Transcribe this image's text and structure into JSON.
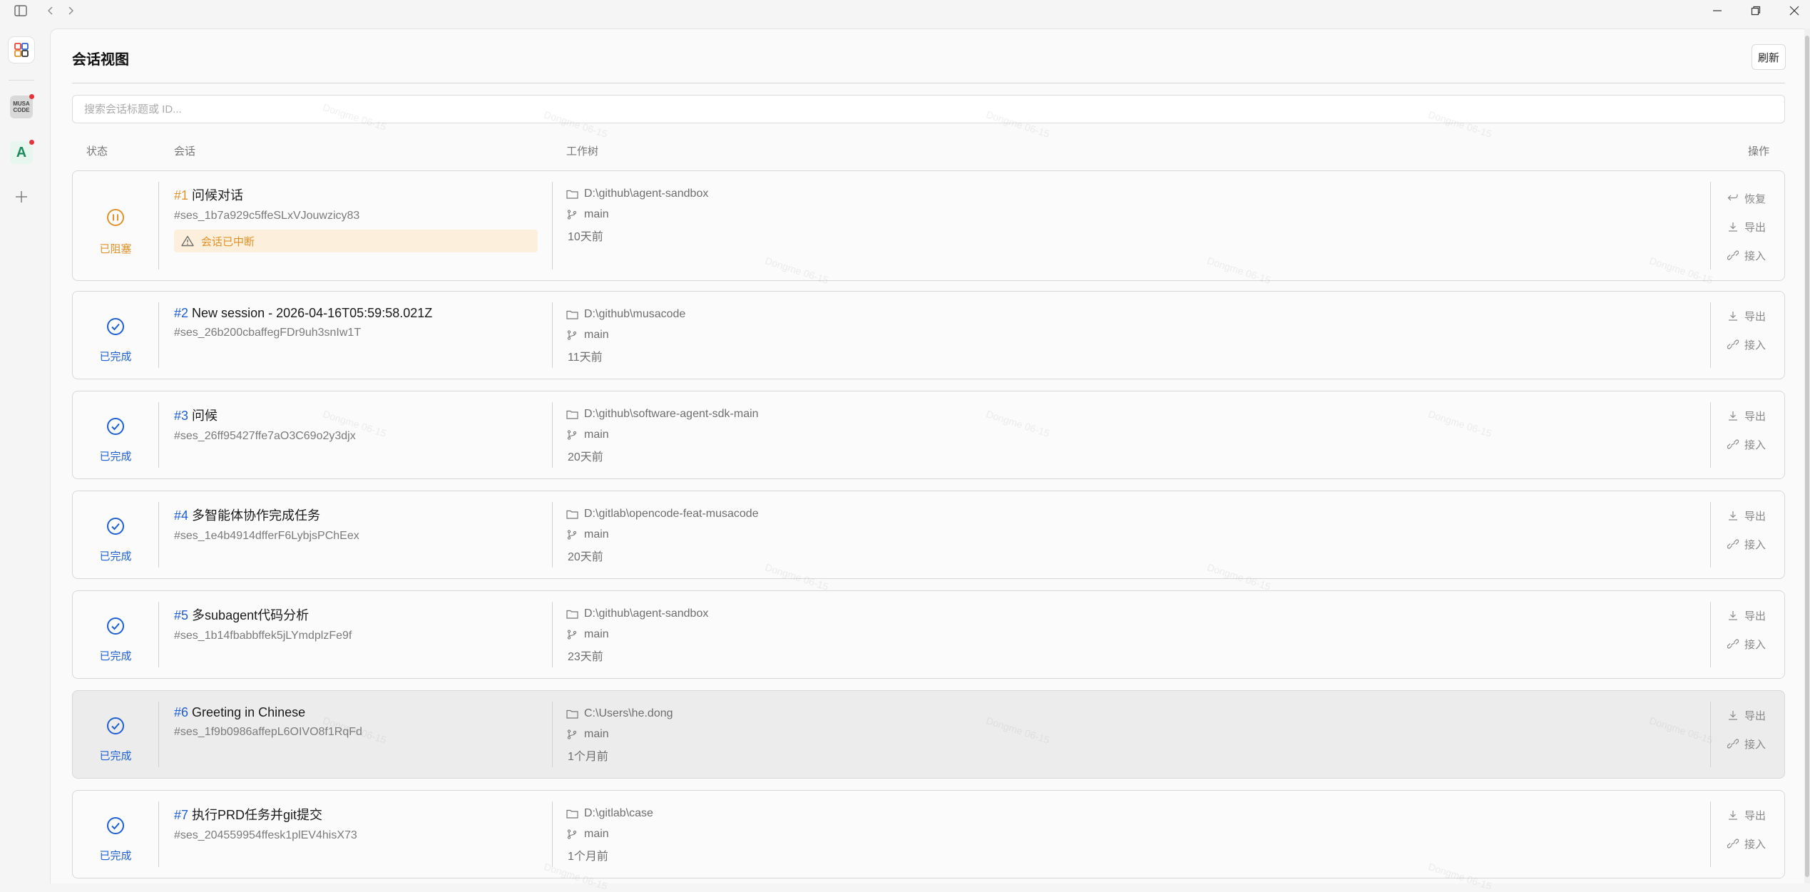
{
  "window": {
    "controls": [
      "sidebar-toggle-icon",
      "back-icon",
      "forward-icon",
      "minimize-icon",
      "restore-icon",
      "close-icon"
    ]
  },
  "rail": {
    "items": [
      {
        "name": "sessions-app",
        "icon": "grid-apps-icon",
        "active": true
      },
      {
        "name": "musacode-app",
        "icon_text": "MUSA CODE",
        "badge": true
      },
      {
        "name": "a-app",
        "icon_text": "A",
        "badge": true
      },
      {
        "name": "add-app",
        "icon": "plus-icon"
      }
    ]
  },
  "header": {
    "title": "会话视图",
    "refresh_label": "刷新"
  },
  "search": {
    "placeholder": "搜索会话标题或 ID..."
  },
  "columns": {
    "status": "状态",
    "session": "会话",
    "worktree": "工作树",
    "actions": "操作"
  },
  "colors": {
    "accent_blue": "#1f5fd6",
    "warn_orange": "#e0922a",
    "warn_bg": "#fcefdc"
  },
  "sessions": [
    {
      "num": "#1",
      "title": "问候对话",
      "id": "#ses_1b7a929c5ffeSLxVJouwzicy83",
      "status": "已阻塞",
      "status_kind": "blocked",
      "notice": "会话已中断",
      "path": "D:\\github\\agent-sandbox",
      "branch": "main",
      "time": "10天前",
      "actions": [
        "恢复",
        "导出",
        "接入"
      ]
    },
    {
      "num": "#2",
      "title": "New session - 2026-04-16T05:59:58.021Z",
      "id": "#ses_26b200cbaffegFDr9uh3snIw1T",
      "status": "已完成",
      "status_kind": "done",
      "path": "D:\\github\\musacode",
      "branch": "main",
      "time": "11天前",
      "actions": [
        "导出",
        "接入"
      ]
    },
    {
      "num": "#3",
      "title": "问候",
      "id": "#ses_26ff95427ffe7aO3C69o2y3djx",
      "status": "已完成",
      "status_kind": "done",
      "path": "D:\\github\\software-agent-sdk-main",
      "branch": "main",
      "time": "20天前",
      "actions": [
        "导出",
        "接入"
      ]
    },
    {
      "num": "#4",
      "title": "多智能体协作完成任务",
      "id": "#ses_1e4b4914dfferF6LybjsPChEex",
      "status": "已完成",
      "status_kind": "done",
      "path": "D:\\gitlab\\opencode-feat-musacode",
      "branch": "main",
      "time": "20天前",
      "actions": [
        "导出",
        "接入"
      ]
    },
    {
      "num": "#5",
      "title": "多subagent代码分析",
      "id": "#ses_1b14fbabbffek5jLYmdplzFe9f",
      "status": "已完成",
      "status_kind": "done",
      "path": "D:\\github\\agent-sandbox",
      "branch": "main",
      "time": "23天前",
      "actions": [
        "导出",
        "接入"
      ]
    },
    {
      "num": "#6",
      "title": "Greeting in Chinese",
      "id": "#ses_1f9b0986affepL6OIVO8f1RqFd",
      "status": "已完成",
      "status_kind": "done",
      "path": "C:\\Users\\he.dong",
      "branch": "main",
      "time": "1个月前",
      "actions": [
        "导出",
        "接入"
      ],
      "highlighted": true
    },
    {
      "num": "#7",
      "title": "执行PRD任务并git提交",
      "id": "#ses_204559954ffesk1plEV4hisX73",
      "status": "已完成",
      "status_kind": "done",
      "path": "D:\\gitlab\\case",
      "branch": "main",
      "time": "1个月前",
      "actions": [
        "导出",
        "接入"
      ]
    }
  ]
}
